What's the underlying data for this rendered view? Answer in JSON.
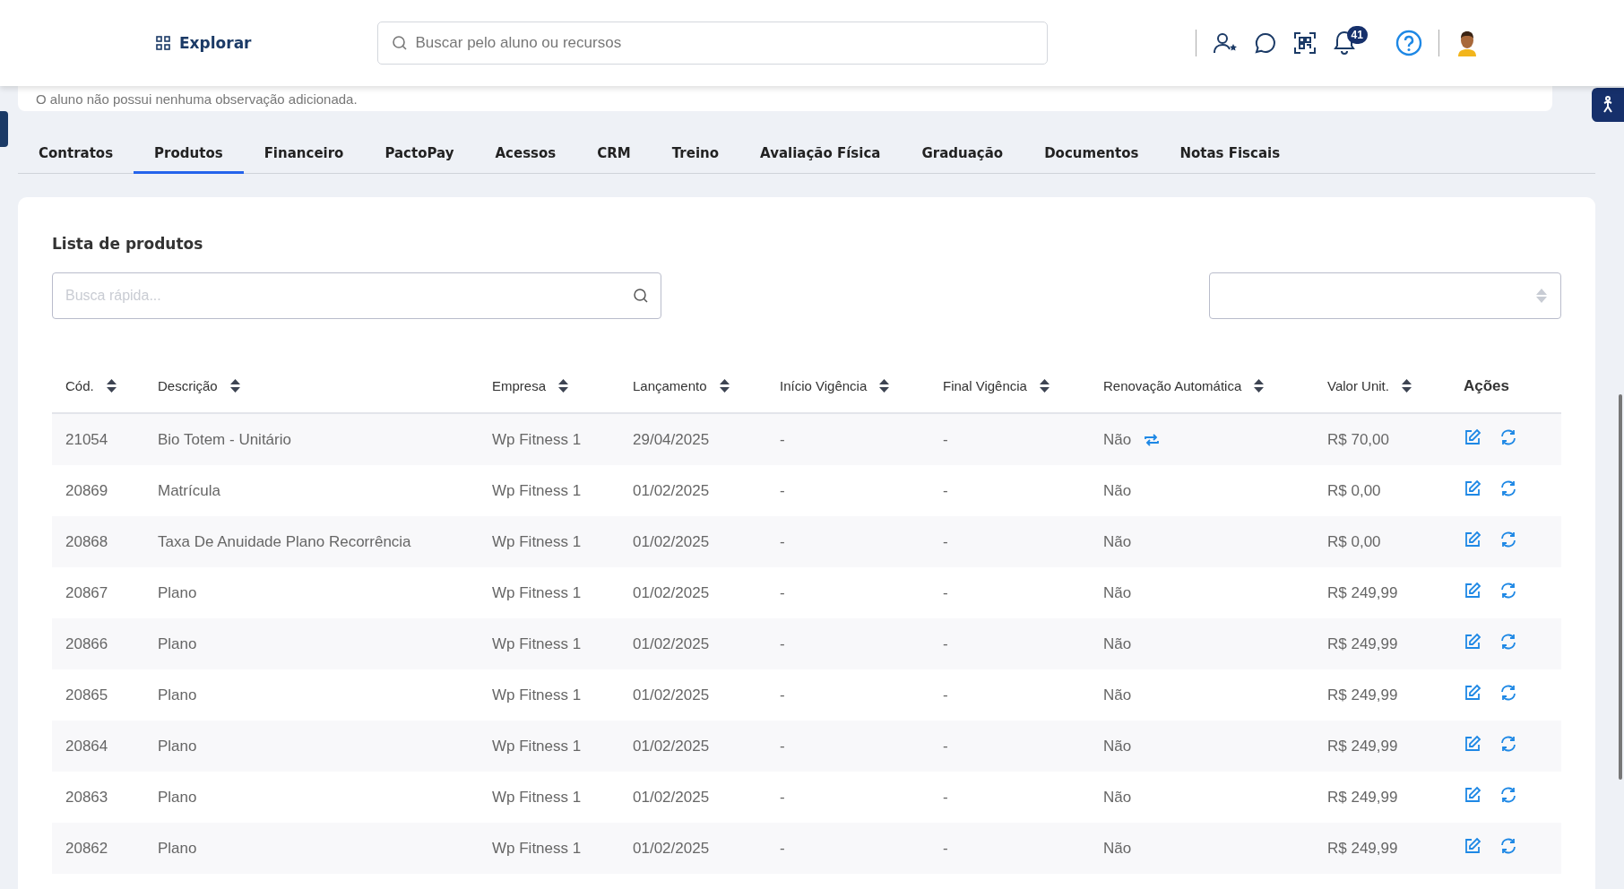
{
  "topbar": {
    "explore": "Explorar",
    "search": {
      "placeholder": "Buscar pelo aluno ou recursos"
    },
    "notifications": "41"
  },
  "observation": "O aluno não possui nenhuma observação adicionada.",
  "tabs": [
    {
      "label": "Contratos",
      "selected": false
    },
    {
      "label": "Produtos",
      "selected": true
    },
    {
      "label": "Financeiro",
      "selected": false
    },
    {
      "label": "PactoPay",
      "selected": false
    },
    {
      "label": "Acessos",
      "selected": false
    },
    {
      "label": "CRM",
      "selected": false
    },
    {
      "label": "Treino",
      "selected": false
    },
    {
      "label": "Avaliação Física",
      "selected": false
    },
    {
      "label": "Graduação",
      "selected": false
    },
    {
      "label": "Documentos",
      "selected": false
    },
    {
      "label": "Notas Fiscais",
      "selected": false
    }
  ],
  "products": {
    "title": "Lista de produtos",
    "search": {
      "placeholder": "Busca rápida..."
    },
    "columns": [
      {
        "label": "Cód.",
        "sortable": true
      },
      {
        "label": "Descrição",
        "sortable": true
      },
      {
        "label": "Empresa",
        "sortable": true
      },
      {
        "label": "Lançamento",
        "sortable": true
      },
      {
        "label": "Início Vigência",
        "sortable": true
      },
      {
        "label": "Final Vigência",
        "sortable": true
      },
      {
        "label": "Renovação Automática",
        "sortable": true
      },
      {
        "label": "Valor Unit.",
        "sortable": true
      },
      {
        "label": "Ações",
        "sortable": false
      }
    ],
    "rows": [
      {
        "code": "21054",
        "description": "Bio Totem - Unitário",
        "company": "Wp Fitness 1",
        "date": "29/04/2025",
        "start": "-",
        "end": "-",
        "renewal": "Não",
        "renew_icon": true,
        "value": "R$ 70,00"
      },
      {
        "code": "20869",
        "description": "Matrícula",
        "company": "Wp Fitness 1",
        "date": "01/02/2025",
        "start": "-",
        "end": "-",
        "renewal": "Não",
        "renew_icon": false,
        "value": "R$ 0,00"
      },
      {
        "code": "20868",
        "description": "Taxa De Anuidade Plano Recorrência",
        "company": "Wp Fitness 1",
        "date": "01/02/2025",
        "start": "-",
        "end": "-",
        "renewal": "Não",
        "renew_icon": false,
        "value": "R$ 0,00"
      },
      {
        "code": "20867",
        "description": "Plano",
        "company": "Wp Fitness 1",
        "date": "01/02/2025",
        "start": "-",
        "end": "-",
        "renewal": "Não",
        "renew_icon": false,
        "value": "R$ 249,99"
      },
      {
        "code": "20866",
        "description": "Plano",
        "company": "Wp Fitness 1",
        "date": "01/02/2025",
        "start": "-",
        "end": "-",
        "renewal": "Não",
        "renew_icon": false,
        "value": "R$ 249,99"
      },
      {
        "code": "20865",
        "description": "Plano",
        "company": "Wp Fitness 1",
        "date": "01/02/2025",
        "start": "-",
        "end": "-",
        "renewal": "Não",
        "renew_icon": false,
        "value": "R$ 249,99"
      },
      {
        "code": "20864",
        "description": "Plano",
        "company": "Wp Fitness 1",
        "date": "01/02/2025",
        "start": "-",
        "end": "-",
        "renewal": "Não",
        "renew_icon": false,
        "value": "R$ 249,99"
      },
      {
        "code": "20863",
        "description": "Plano",
        "company": "Wp Fitness 1",
        "date": "01/02/2025",
        "start": "-",
        "end": "-",
        "renewal": "Não",
        "renew_icon": false,
        "value": "R$ 249,99"
      },
      {
        "code": "20862",
        "description": "Plano",
        "company": "Wp Fitness 1",
        "date": "01/02/2025",
        "start": "-",
        "end": "-",
        "renewal": "Não",
        "renew_icon": false,
        "value": "R$ 249,99"
      }
    ]
  }
}
